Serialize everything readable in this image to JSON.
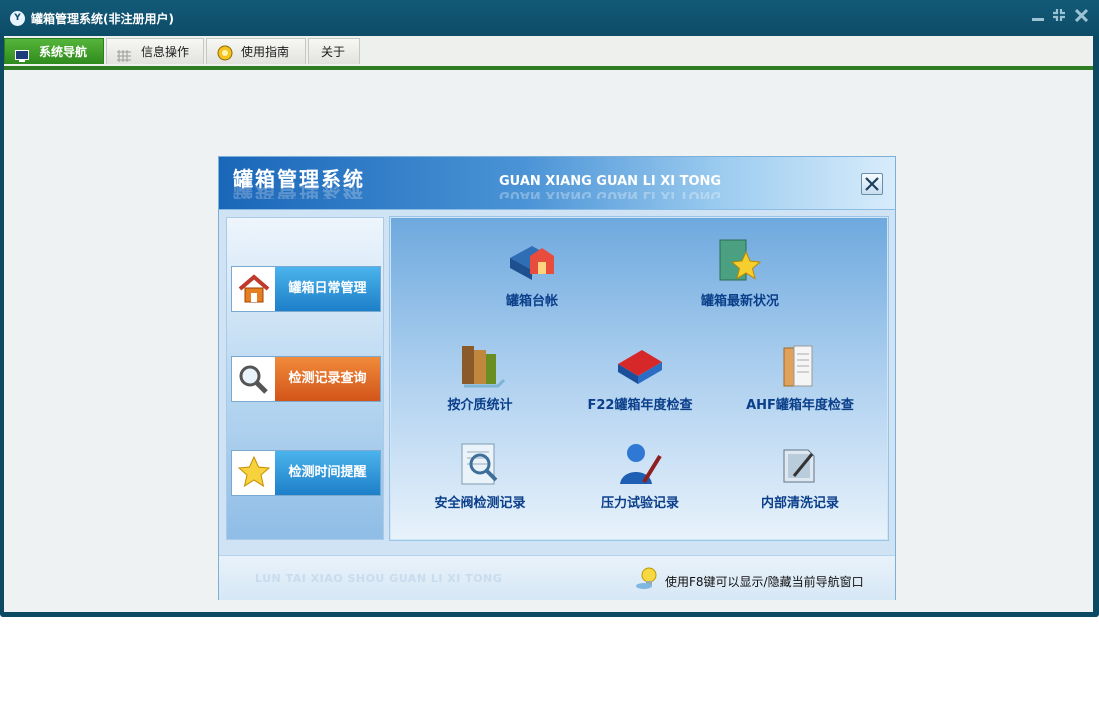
{
  "window": {
    "title": "罐箱管理系统(非注册用户)",
    "app_icon": "yo-logo-icon",
    "controls": [
      "minimize-icon",
      "restore-icon",
      "close-icon"
    ]
  },
  "menu": {
    "tabs": [
      {
        "label": "系统导航",
        "icon": "monitor-icon",
        "active": true
      },
      {
        "label": "信息操作",
        "icon": "grid-icon",
        "active": false
      },
      {
        "label": "使用指南",
        "icon": "compass-icon",
        "active": false
      },
      {
        "label": "关于",
        "icon": "",
        "active": false
      }
    ]
  },
  "dialog": {
    "title": "罐箱管理系统",
    "subtitle": "GUAN XIANG GUAN LI XI TONG",
    "close_label": "✕",
    "left_buttons": [
      {
        "label": "罐箱日常管理",
        "icon": "house-icon",
        "style": "blue"
      },
      {
        "label": "检测记录查询",
        "icon": "magnifier-icon",
        "style": "orange"
      },
      {
        "label": "检测时间提醒",
        "icon": "star-icon",
        "style": "blue"
      }
    ],
    "items": [
      {
        "label": "罐箱台帐",
        "icon": "house-book-icon"
      },
      {
        "label": "罐箱最新状况",
        "icon": "star-card-icon"
      },
      {
        "label": "按介质统计",
        "icon": "books-icon"
      },
      {
        "label": "F22罐箱年度检查",
        "icon": "red-folder-icon"
      },
      {
        "label": "AHF罐箱年度检查",
        "icon": "paper-stack-icon"
      },
      {
        "label": "安全阀检测记录",
        "icon": "search-document-icon"
      },
      {
        "label": "压力试验记录",
        "icon": "user-pen-icon"
      },
      {
        "label": "内部清洗记录",
        "icon": "edit-folder-icon"
      }
    ],
    "footer": {
      "watermark": "LUN TAI XIAO SHOU GUAN LI XI TONG",
      "tip": "使用F8键可以显示/隐藏当前导航窗口",
      "tip_icon": "lightbulb-icon"
    }
  },
  "colors": {
    "titlebar": "#0d4c67",
    "active_tab": "#3a9a26",
    "accent_blue": "#1d7fc8",
    "accent_orange": "#d2551a",
    "item_text": "#0b3f8a"
  }
}
